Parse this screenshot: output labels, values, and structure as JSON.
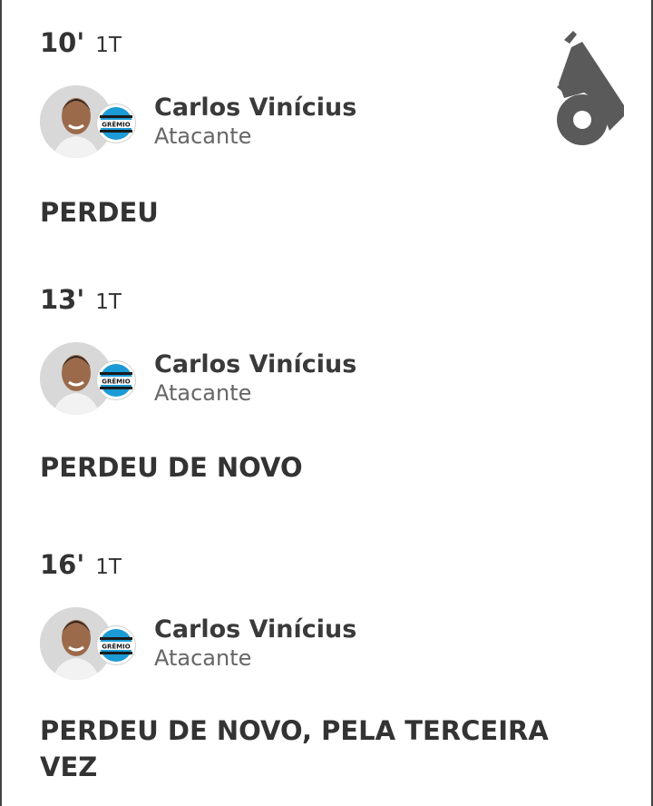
{
  "events": [
    {
      "minute": "10'",
      "half": "1T",
      "player_name": "Carlos Vinícius",
      "player_position": "Atacante",
      "team_badge_text": "GRÊMIO",
      "description": "PERDEU"
    },
    {
      "minute": "13'",
      "half": "1T",
      "player_name": "Carlos Vinícius",
      "player_position": "Atacante",
      "team_badge_text": "GRÊMIO",
      "description": "PERDEU DE NOVO"
    },
    {
      "minute": "16'",
      "half": "1T",
      "player_name": "Carlos Vinícius",
      "player_position": "Atacante",
      "team_badge_text": "GRÊMIO",
      "description": "PERDEU DE NOVO, PELA TERCEIRA VEZ"
    }
  ],
  "icons": {
    "event_type": "whistle-icon"
  },
  "colors": {
    "text_primary": "#333333",
    "text_secondary": "#666666",
    "icon": "#5a5a5a",
    "team_blue": "#1b9ad6"
  }
}
